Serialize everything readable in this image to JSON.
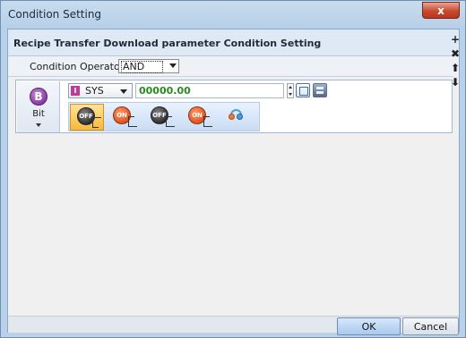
{
  "window": {
    "title": "Condition Setting",
    "close_glyph": "x"
  },
  "header": {
    "title": "Recipe Transfer Download parameter Condition Setting"
  },
  "operator": {
    "label": "Condition Operator[O] :",
    "value": "AND"
  },
  "side_tools": [
    "plus-icon",
    "delete-icon",
    "move-up-icon",
    "move-down-icon"
  ],
  "condition": {
    "type_badge": "B",
    "type_label": "Bit",
    "device_chip": "I",
    "device": "SYS",
    "address": "00000.00",
    "ops": [
      {
        "icon": "off-falling-edge-icon",
        "text": "OFF",
        "selected": true
      },
      {
        "icon": "on-rising-edge-icon",
        "text": "ON",
        "selected": false
      },
      {
        "icon": "off-rising-edge-icon",
        "text": "OFF",
        "selected": false
      },
      {
        "icon": "on-rising-edge-icon",
        "text": "ON",
        "selected": false
      },
      {
        "icon": "change-icon",
        "text": "",
        "selected": false
      }
    ]
  },
  "buttons": {
    "ok": "OK",
    "cancel": "Cancel"
  },
  "colors": {
    "address_text": "#2b8a1f",
    "bit_badge": "#8a3aa6",
    "close": "#c74a30",
    "selected_op": "#f5b93b"
  }
}
